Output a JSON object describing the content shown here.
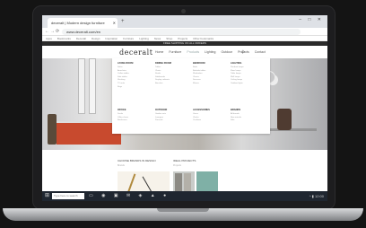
{
  "browser": {
    "tab_title": "deceralt | Modern design furniture",
    "new_tab": "+",
    "window_controls": "– □ ✕",
    "url": "www.deceralt.com/en",
    "back": "←",
    "forward": "→",
    "reload": "⟳",
    "bookmarks": [
      "Apps",
      "Bookmarks",
      "Deceralt",
      "Design",
      "Inspiration",
      "Furniture",
      "Lighting",
      "News",
      "Shop",
      "Projects",
      "Other bookmarks"
    ]
  },
  "site": {
    "promo": "FREE SHIPPING ON ALL ORDERS",
    "logo": "deceralt",
    "nav": [
      "Home",
      "Furniture",
      "Products",
      "Lighting",
      "Outdoor",
      "Projects",
      "Contact"
    ],
    "cart_icon": "cart-icon",
    "mega_menu": [
      {
        "heading": "LIVING ROOM",
        "items": [
          "Sofas",
          "Armchairs",
          "Coffee tables",
          "Side tables",
          "Shelving",
          "TV units",
          "Rugs"
        ]
      },
      {
        "heading": "DINING ROOM",
        "items": [
          "Tables",
          "Chairs",
          "Stools",
          "Sideboards",
          "Display cabinets",
          "Benches"
        ]
      },
      {
        "heading": "BEDROOM",
        "items": [
          "Beds",
          "Bedside tables",
          "Wardrobes",
          "Chests",
          "Dressers",
          "Mirrors"
        ]
      },
      {
        "heading": "LIGHTING",
        "items": [
          "Pendant lamps",
          "Floor lamps",
          "Table lamps",
          "Wall lamps",
          "Ceiling lamps",
          "Outdoor lights"
        ]
      },
      {
        "heading": "OFFICE",
        "items": [
          "Desks",
          "Office chairs",
          "Bookcases"
        ]
      },
      {
        "heading": "OUTDOOR",
        "items": [
          "Garden sets",
          "Loungers",
          "Parasols"
        ]
      },
      {
        "heading": "ACCESSORIES",
        "items": [
          "Vases",
          "Clocks",
          "Cushions"
        ]
      },
      {
        "heading": "BRANDS",
        "items": [
          "All brands",
          "New arrivals",
          "Sale"
        ]
      }
    ],
    "section_left_title": "CHOOSE BRANDS IN DESIGN",
    "section_left_sub": "Brands",
    "section_right_title": "IDEAL PROJECTS",
    "section_right_sub": "Projects"
  },
  "taskbar": {
    "start": "⊞",
    "search_placeholder": "Type here to search",
    "icons": "▭ ◉ ▣ ✉ ◈ ▲ ●",
    "tray": "^ ▮ 12:00"
  }
}
